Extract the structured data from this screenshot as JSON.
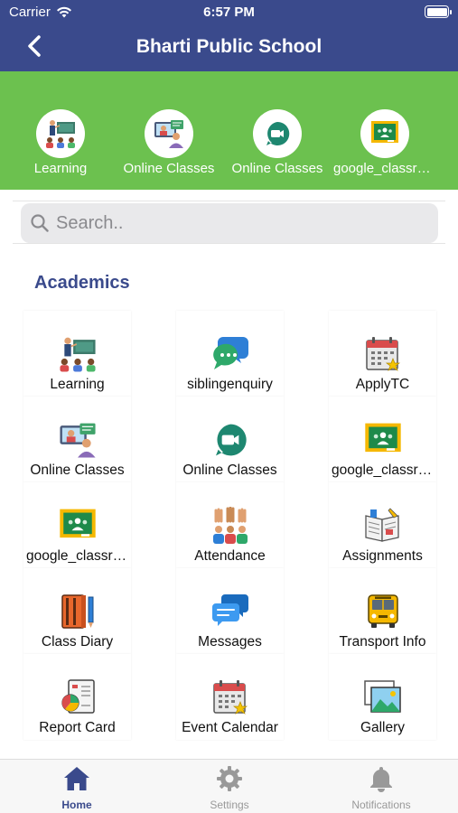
{
  "status": {
    "carrier": "Carrier",
    "time": "6:57 PM"
  },
  "header": {
    "title": "Bharti Public School"
  },
  "quick_links": [
    {
      "label": "Learning",
      "icon": "learning-icon"
    },
    {
      "label": "Online Classes",
      "icon": "online-classes-icon"
    },
    {
      "label": "Online Classes",
      "icon": "google-meet-icon"
    },
    {
      "label": "google_classroom",
      "icon": "google-classroom-icon"
    }
  ],
  "search": {
    "placeholder": "Search.."
  },
  "section": {
    "title": "Academics"
  },
  "grid": [
    {
      "label": "Learning",
      "icon": "learning-icon"
    },
    {
      "label": "siblingenquiry",
      "icon": "chat-bubbles-icon"
    },
    {
      "label": "ApplyTC",
      "icon": "calendar-star-icon"
    },
    {
      "label": "Online Classes",
      "icon": "online-classes-icon"
    },
    {
      "label": "Online Classes",
      "icon": "google-meet-icon"
    },
    {
      "label": "google_classroom",
      "icon": "google-classroom-icon"
    },
    {
      "label": "google_classroom",
      "icon": "google-classroom-icon"
    },
    {
      "label": "Attendance",
      "icon": "raised-hands-icon"
    },
    {
      "label": "Assignments",
      "icon": "assignment-book-icon"
    },
    {
      "label": "Class Diary",
      "icon": "diary-icon"
    },
    {
      "label": "Messages",
      "icon": "messages-icon"
    },
    {
      "label": "Transport Info",
      "icon": "school-bus-icon"
    },
    {
      "label": "Report Card",
      "icon": "report-card-icon"
    },
    {
      "label": "Event Calendar",
      "icon": "event-calendar-icon"
    },
    {
      "label": "Gallery",
      "icon": "gallery-icon"
    }
  ],
  "tabs": [
    {
      "label": "Home",
      "icon": "home-icon",
      "active": true
    },
    {
      "label": "Settings",
      "icon": "gear-icon",
      "active": false
    },
    {
      "label": "Notifications",
      "icon": "bell-icon",
      "active": false
    }
  ],
  "colors": {
    "header": "#3a4a8c",
    "quick_bar": "#6cc14f",
    "accent": "#3a4a8c"
  }
}
